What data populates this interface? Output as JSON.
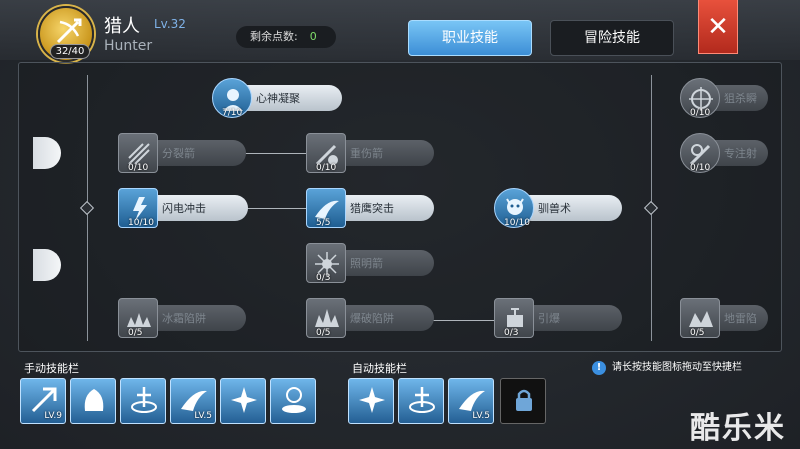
{
  "header": {
    "job_level_pill": "32/40",
    "job_name": "猎人",
    "job_level": "Lv.32",
    "job_english": "Hunter",
    "points_label": "剩余点数:",
    "points_value": "0",
    "tabs": [
      {
        "label": "职业技能",
        "active": true
      },
      {
        "label": "冒险技能",
        "active": false
      }
    ],
    "close_label": "✕"
  },
  "skills": [
    {
      "id": "s1",
      "label": "心神凝聚",
      "count": "7/10",
      "unlocked": true,
      "round": true
    },
    {
      "id": "s2",
      "label": "分裂箭",
      "count": "0/10",
      "unlocked": false
    },
    {
      "id": "s3",
      "label": "重伤箭",
      "count": "0/10",
      "unlocked": false
    },
    {
      "id": "s4",
      "label": "闪电冲击",
      "count": "10/10",
      "unlocked": true
    },
    {
      "id": "s5",
      "label": "猎鹰突击",
      "count": "5/5",
      "unlocked": true
    },
    {
      "id": "s6",
      "label": "驯兽术",
      "count": "10/10",
      "unlocked": true,
      "round": true
    },
    {
      "id": "s7",
      "label": "照明箭",
      "count": "0/3",
      "unlocked": false
    },
    {
      "id": "s8",
      "label": "冰霜陷阱",
      "count": "0/5",
      "unlocked": false
    },
    {
      "id": "s9",
      "label": "爆破陷阱",
      "count": "0/5",
      "unlocked": false
    },
    {
      "id": "s10",
      "label": "引爆",
      "count": "0/3",
      "unlocked": false
    },
    {
      "id": "s11",
      "label": "狙杀瞬",
      "count": "0/10",
      "unlocked": false,
      "round": true
    },
    {
      "id": "s12",
      "label": "专注射",
      "count": "0/10",
      "unlocked": false,
      "round": true
    },
    {
      "id": "s13",
      "label": "地雷陷",
      "count": "0/5",
      "unlocked": false
    }
  ],
  "manual_bar": {
    "title": "手动技能栏",
    "slots": [
      {
        "icon": "lightning-arrow-icon",
        "level": "LV.9"
      },
      {
        "icon": "palm-icon",
        "level": ""
      },
      {
        "icon": "circle-cross-icon",
        "level": ""
      },
      {
        "icon": "falcon-strike-icon",
        "level": "LV.5"
      },
      {
        "icon": "burst-blade-icon",
        "level": ""
      },
      {
        "icon": "summon-icon",
        "level": ""
      }
    ]
  },
  "auto_bar": {
    "title": "自动技能栏",
    "slots": [
      {
        "icon": "burst-blade-icon",
        "level": ""
      },
      {
        "icon": "circle-cross-icon",
        "level": ""
      },
      {
        "icon": "falcon-strike-icon",
        "level": "LV.5"
      },
      {
        "icon": "lock-icon",
        "level": "",
        "locked": true
      }
    ]
  },
  "hint": "请长按技能图标拖动至快捷栏",
  "watermark": "酷乐米",
  "colors": {
    "accent": "#3c8ed6",
    "close": "#d23c2a",
    "points": "#7fdc6a"
  }
}
